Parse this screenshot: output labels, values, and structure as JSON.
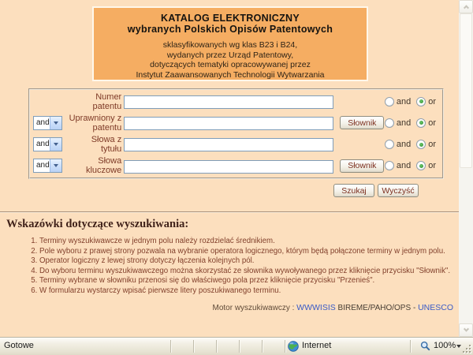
{
  "header": {
    "title_line1": "KATALOG ELEKTRONICZNY",
    "title_line2": "wybranych Polskich Opisów Patentowych",
    "subtitle_lines": [
      "sklasyfikowanych wg klas B23 i B24,",
      "wydanych przez Urząd Patentowy,",
      "dotyczących tematyki opracowywanej przez",
      "Instytut Zaawansowanych Technologii Wytwarzania"
    ]
  },
  "form": {
    "rows": [
      {
        "operator": null,
        "label": "Numer patentu",
        "value": "",
        "has_dictionary": false
      },
      {
        "operator": "and",
        "label": "Uprawniony z patentu",
        "value": "",
        "has_dictionary": true
      },
      {
        "operator": "and",
        "label": "Słowa z tytułu",
        "value": "",
        "has_dictionary": false
      },
      {
        "operator": "and",
        "label": "Słowa kluczowe",
        "value": "",
        "has_dictionary": true
      }
    ],
    "dictionary_button": "Słownik",
    "radio_and_label": "and",
    "radio_or_label": "or",
    "radio_selected": "or",
    "search_button": "Szukaj",
    "clear_button": "Wyczyść"
  },
  "tips": {
    "heading": "Wskazówki dotyczące wyszukiwania:",
    "items": [
      "Terminy wyszukiwawcze w jednym polu należy rozdzielać średnikiem.",
      "Pole wyboru z prawej strony pozwala na wybranie operatora logicznego, którym będą połączone terminy w jednym polu.",
      "Operator logiczny z lewej strony dotyczy łączenia kolejnych pól.",
      "Do wyboru terminu wyszukiwawczego można skorzystać ze słownika wywoływanego przez kliknięcie przycisku \"Słownik\".",
      "Terminy wybrane w słowniku przenosi się do właściwego pola przez kliknięcie przycisku \"Przenieś\".",
      "W formularzu wystarczy wpisać pierwsze litery poszukiwanego terminu."
    ]
  },
  "footer": {
    "label": "Motor wyszukiwawczy :",
    "engine_link": "WWWISIS",
    "engine_suffix": "BIREME/PAHO/OPS",
    "separator": "-",
    "org_link": "UNESCO"
  },
  "statusbar": {
    "status_text": "Gotowe",
    "zone_text": "Internet",
    "zoom_level": "100%"
  },
  "colors": {
    "page_bg": "#FCDFBE",
    "header_panel_bg": "#F5AD62",
    "text_maroon": "#82402C",
    "heading_color": "#40221A",
    "link_blue": "#3A5BC7",
    "radio_selected_green": "#2E8B2E",
    "input_border": "#7F9DB9"
  }
}
